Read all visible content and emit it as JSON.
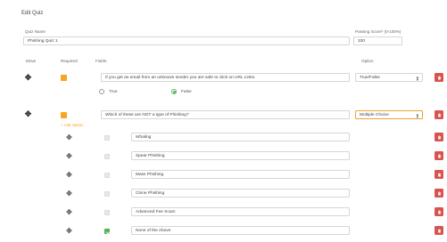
{
  "page": {
    "title": "Edit Quiz"
  },
  "quiz": {
    "name_label": "Quiz Name",
    "name_value": "Phishing Quiz 1",
    "passing_label": "Passing Score* (0-100%)",
    "passing_value": "100"
  },
  "columns": {
    "move": "Move",
    "required": "Required",
    "fields": "Fields",
    "option": "Option"
  },
  "questions": [
    {
      "text": "If you get an email from an unknown sender you are safe to click on URL Links.",
      "type": "True/False",
      "answers": [
        {
          "label": "True",
          "selected": false
        },
        {
          "label": "False",
          "selected": true
        }
      ]
    },
    {
      "text": "Which of these are NOT a type of Phishing?",
      "type": "Multiple Choice",
      "add_option_label": "+ Add Option",
      "options": [
        {
          "text": "Whaling",
          "correct": false
        },
        {
          "text": "Spear Phishing",
          "correct": false
        },
        {
          "text": "Mass Phishing",
          "correct": false
        },
        {
          "text": "Clone Phishing",
          "correct": false
        },
        {
          "text": "Advanced Fee Scam",
          "correct": false
        },
        {
          "text": "None of the Above",
          "correct": true
        }
      ]
    }
  ],
  "icons": {
    "move": "move-arrows-icon",
    "delete": "trash-icon",
    "select": "select-updown-icon"
  },
  "colors": {
    "required": "#f5a623",
    "delete": "#d9534f",
    "correct": "#5cb85c",
    "focus": "#f0a030"
  }
}
